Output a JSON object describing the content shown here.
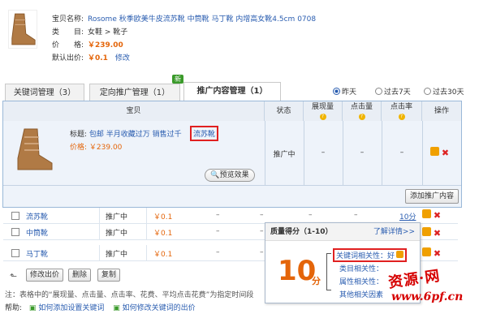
{
  "product": {
    "name_label": "宝贝名称:",
    "name_value": "Rosome 秋季欧美牛皮流苏靴 中筒靴 马丁靴 内增高女靴4.5cm 0708",
    "category_label": "类　　目:",
    "category_value": "女鞋 > 靴子",
    "price_label": "价　　格:",
    "price_value": "￥239.00",
    "bid_label": "默认出价:",
    "bid_value": "￥0.1",
    "edit_link": "修改"
  },
  "tabs": [
    {
      "label": "关键词管理（3）"
    },
    {
      "label": "定向推广管理（1）"
    },
    {
      "label": "推广内容管理（1）"
    }
  ],
  "new_badge": "新",
  "range": {
    "yesterday": "昨天",
    "past7": "过去7天",
    "past30": "过去30天",
    "selected": "昨天"
  },
  "table_header": {
    "item": "宝贝",
    "status": "状态",
    "impressions": "展现量",
    "clicks": "点击量",
    "ctr": "点击率",
    "action": "操作"
  },
  "row": {
    "title_label": "标题:",
    "title_value": "包邮 半月收藏过万 销售过千",
    "title_highlight": "流苏靴",
    "price_label": "价格:",
    "price_value": "￥239.00",
    "preview_btn": "预览效果",
    "status": "推广中",
    "impressions": "–",
    "clicks": "–",
    "ctr": "–"
  },
  "add_content_btn": "添加推广内容",
  "lower_rows": [
    {
      "name": "流苏靴",
      "status": "推广中",
      "price": "￥0.1",
      "a": "–",
      "b": "–",
      "c": "–",
      "d": "–",
      "rank": "10分"
    },
    {
      "name": "中筒靴",
      "status": "推广中",
      "price": "￥0.1",
      "a": "–",
      "b": "–",
      "c": "–",
      "d": "–",
      "rank": ""
    },
    {
      "name": "马丁靴",
      "status": "推广中",
      "price": "￥0.1",
      "a": "–",
      "b": "–",
      "c": "–",
      "d": "–",
      "rank": ""
    }
  ],
  "bottom_buttons": {
    "edit_bid": "修改出价",
    "delete": "删除",
    "copy": "复制"
  },
  "popup": {
    "title": "质量得分（1-10）",
    "detail_link": "了解详情>>",
    "score": "10",
    "unit": "分",
    "kw_rel": "关键词相关性：好",
    "cat_rel": "类目相关性：",
    "attr_rel": "属性相关性：",
    "other": "其他相关因素"
  },
  "note": "注：表格中的“展现量、点击量、点击率、花费、平均点击花费”为指定时间段",
  "help_label": "帮助:",
  "help_links": [
    "如何添加设置关键词",
    "如何修改关键词的出价"
  ],
  "watermark": {
    "line1": "资源·网",
    "line2": "www.6pf.cn"
  },
  "colors": {
    "accent_orange": "#e4650a",
    "link_blue": "#2a5db0",
    "highlight_red": "#e02020"
  }
}
